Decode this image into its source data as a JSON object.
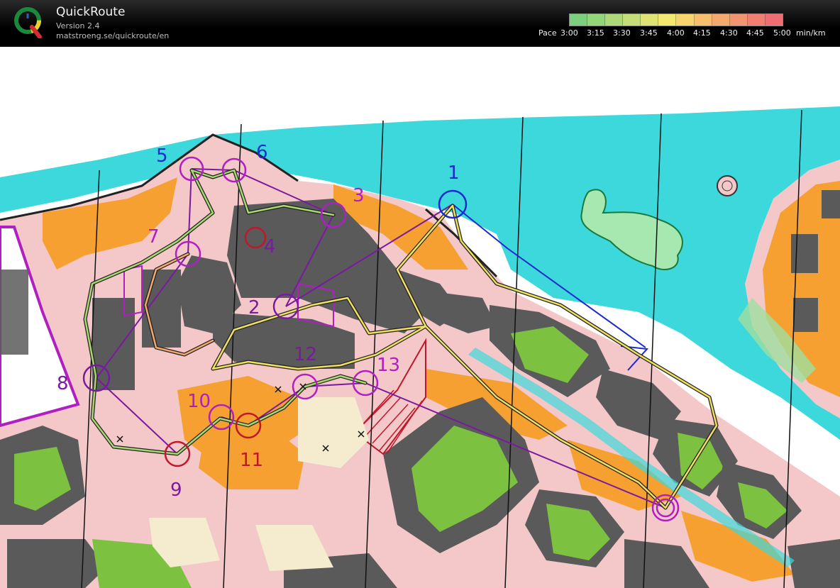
{
  "app": {
    "title": "QuickRoute",
    "version": "Version 2.4",
    "url": "matstroeng.se/quickroute/en",
    "logo_letter": "Q"
  },
  "pace_scale": {
    "label": "Pace",
    "unit": "min/km",
    "ticks": [
      "3:00",
      "3:15",
      "3:30",
      "3:45",
      "4:00",
      "4:15",
      "4:30",
      "4:45",
      "5:00"
    ],
    "colors": [
      "#7ccf7c",
      "#93d67a",
      "#add97a",
      "#c6de78",
      "#dfe373",
      "#f3e870",
      "#f8d46e",
      "#f6bf6e",
      "#f4a96e",
      "#f39470",
      "#f07e72",
      "#ee6e74"
    ]
  },
  "map": {
    "control_numbers": {
      "c1": "1",
      "c2": "2",
      "c3": "3",
      "c4": "4",
      "c5": "5",
      "c6": "6",
      "c7": "7",
      "c8": "8",
      "c9": "9",
      "c10": "10",
      "c11": "11",
      "c12": "12",
      "c13": "13"
    },
    "colors": {
      "water": "#3dd8dc",
      "paved": "#f4c8c8",
      "building": "#5a5a5a",
      "vegetation": "#f5a030",
      "green": "#7cc240",
      "course": "#b020c0",
      "course_dark": "#7a1aa0",
      "control_red": "#c0182a",
      "control_blue": "#1a2ad0"
    }
  }
}
